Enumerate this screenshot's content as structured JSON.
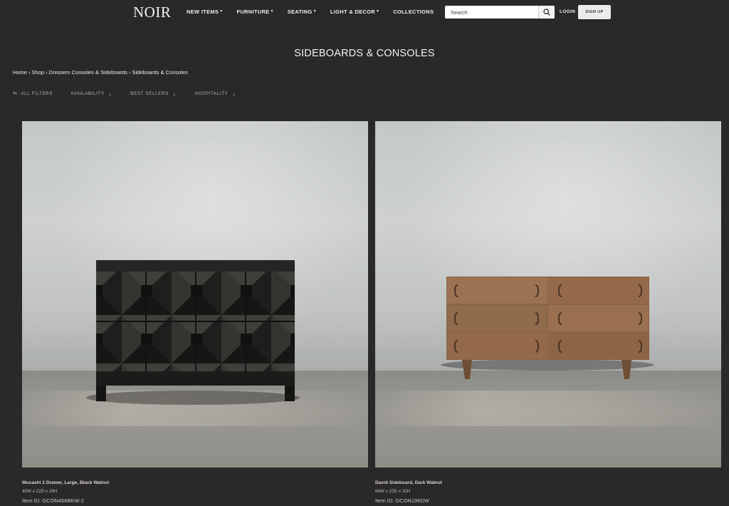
{
  "header": {
    "logo": "NOIR",
    "nav": [
      {
        "label": "NEW ITEMS",
        "dropdown": true
      },
      {
        "label": "FURNITURE",
        "dropdown": true
      },
      {
        "label": "SEATING",
        "dropdown": true
      },
      {
        "label": "LIGHT & DECOR",
        "dropdown": true
      },
      {
        "label": "COLLECTIONS",
        "dropdown": false
      }
    ],
    "search": {
      "placeholder": "Search",
      "icon": "search-icon"
    },
    "login_label": "LOGIN",
    "signup_label": "SIGN UP"
  },
  "page": {
    "title": "SIDEBOARDS & CONSOLES",
    "breadcrumb": [
      "Home",
      "Shop",
      "Dressers Consoles & Sideboards",
      "Sideboards & Consoles"
    ],
    "breadcrumb_separator": "›"
  },
  "filters": [
    {
      "label": "ALL FILTERS",
      "icon": "filter-sliders-icon"
    },
    {
      "label": "AVAILABILITY",
      "icon": "chevron-down-icon"
    },
    {
      "label": "BEST SELLERS",
      "icon": "chevron-down-icon"
    },
    {
      "label": "HOSPITALITY",
      "icon": "chevron-down-icon"
    }
  ],
  "products": [
    {
      "name": "Musashi 2 Drawer, Large, Black Walnut",
      "dims": "40W x 22D x 29H",
      "item_id": "Item ID: GCON458BKW-2"
    },
    {
      "name": "David Sideboard, Dark Walnut",
      "dims": "64W x 23D x 32H",
      "item_id": "Item ID: GCON199DW"
    }
  ],
  "colors": {
    "background": "#2a2828",
    "text": "#e8e6e3",
    "signup_bg": "#ecebe9"
  }
}
